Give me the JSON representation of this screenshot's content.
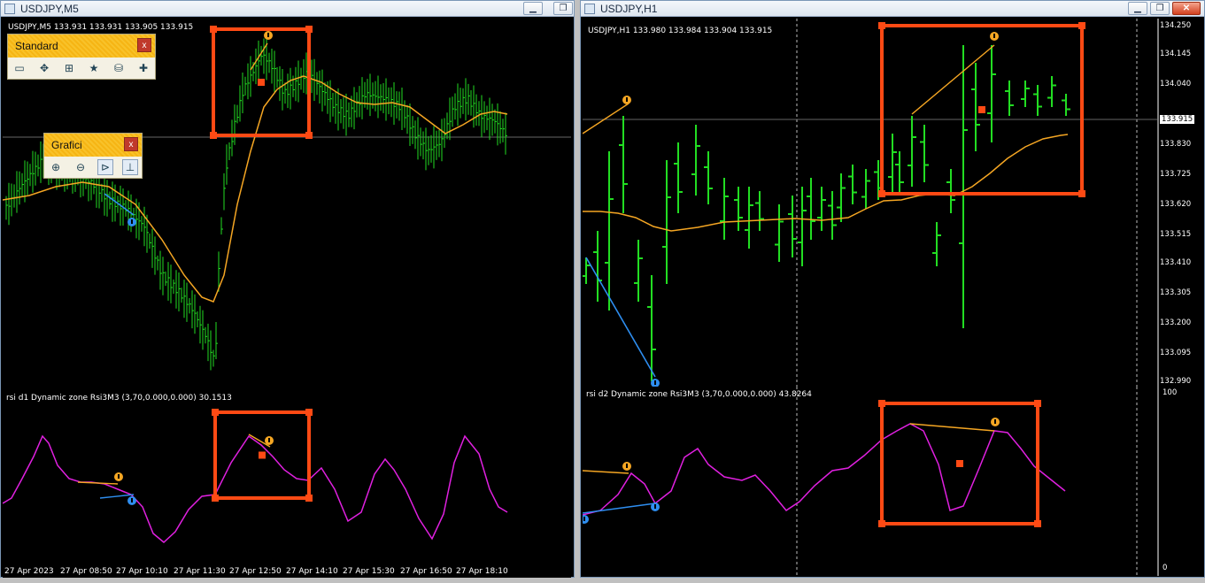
{
  "left_window": {
    "title": "USDJPY,M5",
    "symbol_line": "USDJPY,M5  133.931 133.931 133.905 133.915",
    "indicator_line": "rsi d1 Dynamic zone Rsi3M3 (3,70,0.000,0.000) 30.1513",
    "time_labels": [
      "27 Apr 2023",
      "27 Apr 08:50",
      "27 Apr 10:10",
      "27 Apr 11:30",
      "27 Apr 12:50",
      "27 Apr 14:10",
      "27 Apr 15:30",
      "27 Apr 16:50",
      "27 Apr 18:10"
    ]
  },
  "right_window": {
    "title": "USDJPY,H1",
    "symbol_line": "USDJPY,H1  133.980 133.984 133.904 133.915",
    "indicator_line": "rsi d2 Dynamic zone Rsi3M3 (3,70,0.000,0.000) 43.8264",
    "price_labels": [
      "134.250",
      "134.145",
      "134.040",
      "133.915",
      "133.830",
      "133.725",
      "133.620",
      "133.515",
      "133.410",
      "133.305",
      "133.200",
      "133.095",
      "132.990"
    ],
    "current_price": "133.915",
    "indicator_scale_top": "100",
    "indicator_scale_bottom": "0"
  },
  "toolbar_standard": {
    "title": "Standard",
    "close": "x"
  },
  "toolbar_grafici": {
    "title": "Grafici",
    "close": "x"
  },
  "window_buttons": {
    "minimize": "▁",
    "restore": "❐",
    "close": "✕"
  },
  "colors": {
    "bars": "#22dd22",
    "ma": "#f5a623",
    "rsi": "#e020e0",
    "highlight": "#ff4a14",
    "bull_div": "#2e8ef0",
    "bear_div": "#f5a623"
  }
}
